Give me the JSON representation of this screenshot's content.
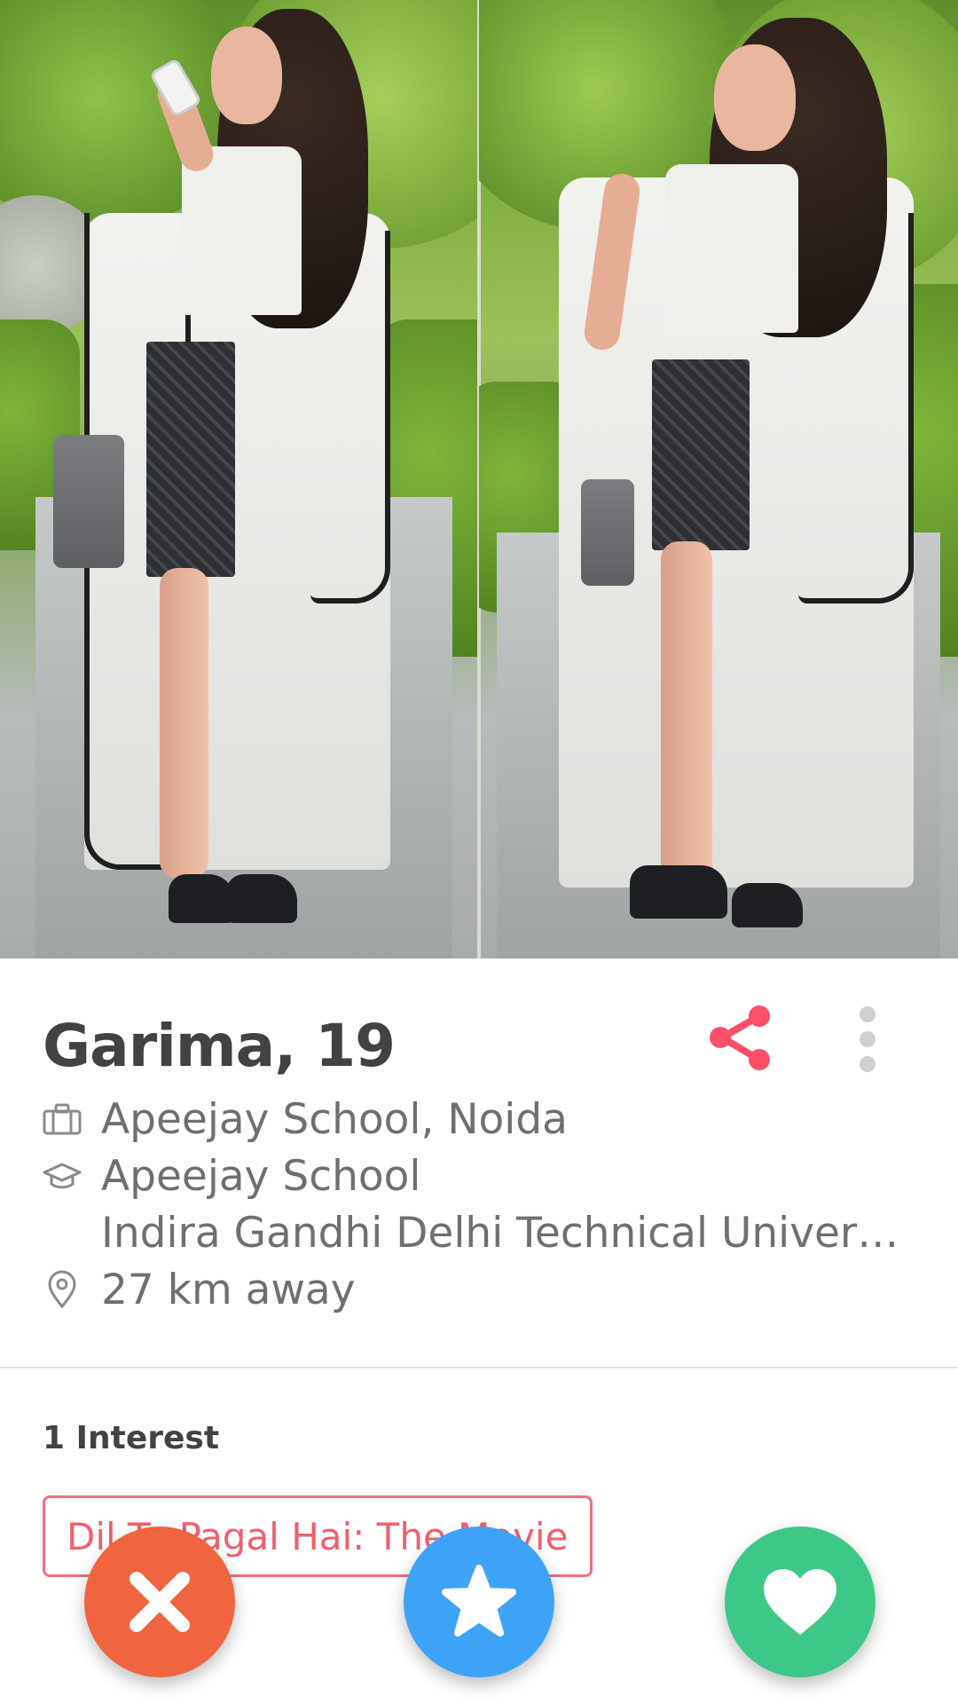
{
  "profile": {
    "name_age": "Garima, 19",
    "job": "Apeejay School, Noida",
    "school": "Apeejay School",
    "school_secondary": "Indira Gandhi Delhi Technical Univers...",
    "distance": "27 km away"
  },
  "interests": {
    "title": "1 Interest",
    "items": [
      "Dil To Pagal Hai: The Movie"
    ]
  },
  "icons": {
    "share": "share-icon",
    "more": "more-vertical-icon",
    "job": "briefcase-icon",
    "school": "graduation-cap-icon",
    "location": "location-pin-icon",
    "nope": "close-icon",
    "super_like": "star-icon",
    "like": "heart-icon"
  },
  "colors": {
    "accent": "#fd5068",
    "nope": "#f0643f",
    "super_like": "#3ea3f7",
    "like": "#3dc888",
    "chip_border": "#f2707a"
  }
}
